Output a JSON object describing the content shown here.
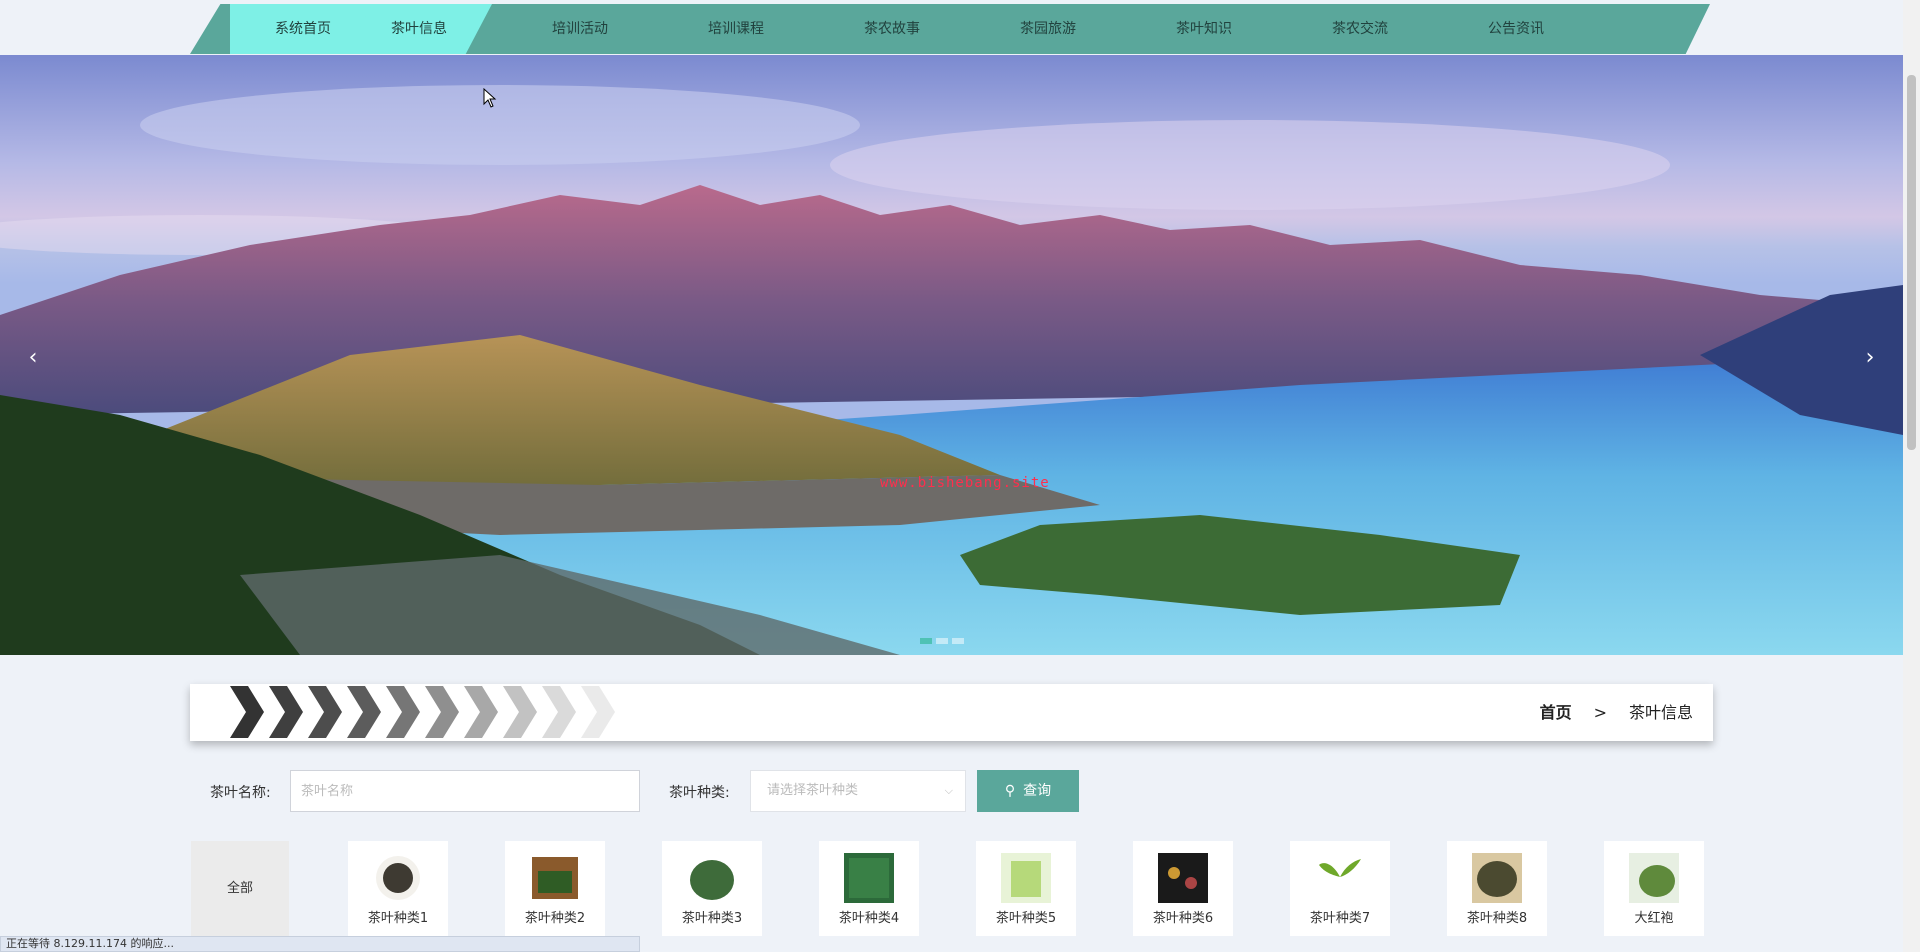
{
  "nav": {
    "items": [
      {
        "label": "系统首页"
      },
      {
        "label": "茶叶信息"
      },
      {
        "label": "培训活动"
      },
      {
        "label": "培训课程"
      },
      {
        "label": "茶农故事"
      },
      {
        "label": "茶园旅游"
      },
      {
        "label": "茶叶知识"
      },
      {
        "label": "茶农交流"
      },
      {
        "label": "公告资讯"
      }
    ],
    "active_color": "#7ef0e6",
    "bar_color": "#5aa79b"
  },
  "banner": {
    "prev_icon": "‹",
    "next_icon": "›",
    "watermark": "www.bishebang.site",
    "slide_count": 3,
    "active_slide": 1
  },
  "breadcrumb": {
    "home": "首页",
    "separator": ">",
    "current": "茶叶信息"
  },
  "search": {
    "name_label": "茶叶名称:",
    "name_placeholder": "茶叶名称",
    "type_label": "茶叶种类:",
    "type_placeholder": "请选择茶叶种类",
    "button_label": "查询"
  },
  "categories": {
    "all_label": "全部",
    "items": [
      {
        "label": "茶叶种类1",
        "icon": "tea-bowl-icon"
      },
      {
        "label": "茶叶种类2",
        "icon": "tea-box-icon"
      },
      {
        "label": "茶叶种类3",
        "icon": "tea-pile-icon"
      },
      {
        "label": "茶叶种类4",
        "icon": "tea-leaves-icon"
      },
      {
        "label": "茶叶种类5",
        "icon": "green-tea-cup-icon"
      },
      {
        "label": "茶叶种类6",
        "icon": "tea-package-icon"
      },
      {
        "label": "茶叶种类7",
        "icon": "tea-sprout-icon"
      },
      {
        "label": "茶叶种类8",
        "icon": "tea-blend-icon"
      },
      {
        "label": "大红袍",
        "icon": "dahongpao-icon"
      }
    ]
  },
  "status_bar": {
    "text": "正在等待 8.129.11.174 的响应..."
  }
}
